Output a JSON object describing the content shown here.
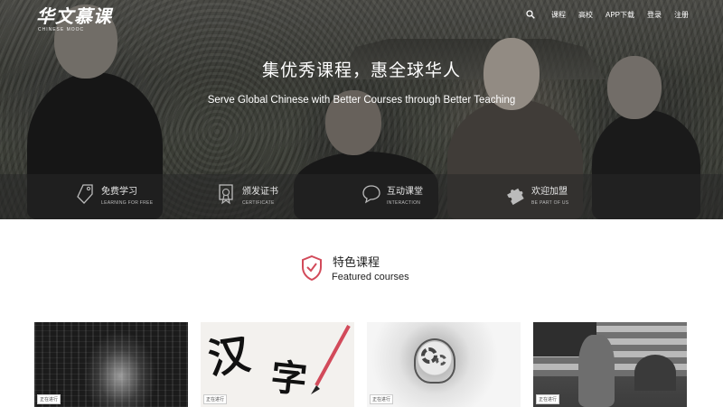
{
  "brand": {
    "logo_cn": "华文慕课",
    "logo_en": "CHINESE MOOC"
  },
  "nav": {
    "search_icon": "search-icon",
    "items": [
      {
        "label": "课程"
      },
      {
        "label": "高校"
      },
      {
        "label": "APP下载"
      },
      {
        "label": "登录"
      },
      {
        "label": "注册"
      }
    ]
  },
  "hero": {
    "title": "集优秀课程，惠全球华人",
    "subtitle": "Serve Global Chinese with Better Courses through Better Teaching"
  },
  "features": [
    {
      "icon": "tag-icon",
      "cn": "免费学习",
      "en": "LEARNING FOR FREE"
    },
    {
      "icon": "certificate-icon",
      "cn": "颁发证书",
      "en": "CERTIFICATE"
    },
    {
      "icon": "chat-bubble-icon",
      "cn": "互动课堂",
      "en": "INTERACTION"
    },
    {
      "icon": "puzzle-icon",
      "cn": "欢迎加盟",
      "en": "BE PART OF US"
    }
  ],
  "featured": {
    "icon": "shield-check-icon",
    "title_cn": "特色课程",
    "title_en": "Featured courses"
  },
  "courses": [
    {
      "badge": "正在进行"
    },
    {
      "badge": "正在进行"
    },
    {
      "badge": "正在进行"
    },
    {
      "badge": "正在进行"
    }
  ],
  "colors": {
    "accent": "#d24a5a",
    "hero_overlay": "#2a2a2a",
    "text": "#222222"
  }
}
